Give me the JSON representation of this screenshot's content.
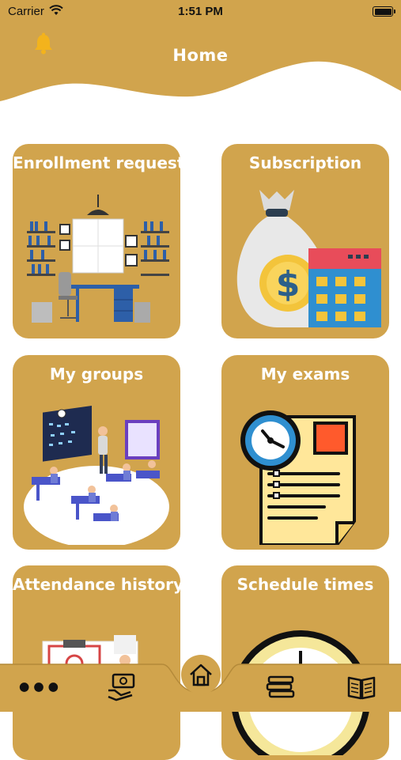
{
  "status_bar": {
    "carrier": "Carrier",
    "time": "1:51 PM"
  },
  "header": {
    "title": "Home"
  },
  "cards": [
    {
      "title": "Enrollment requestes"
    },
    {
      "title": "Subscription"
    },
    {
      "title": "My groups"
    },
    {
      "title": "My exams"
    },
    {
      "title": "Attendance history"
    },
    {
      "title": "Schedule times"
    }
  ],
  "colors": {
    "accent": "#d1a44d",
    "background": "#ffffff",
    "text_on_accent": "#ffffff"
  },
  "icons": {
    "header_left": "bell-icon",
    "tabs": [
      "more-dots-icon",
      "payment-hand-icon",
      "home-icon",
      "stack-books-icon",
      "open-book-icon"
    ]
  }
}
